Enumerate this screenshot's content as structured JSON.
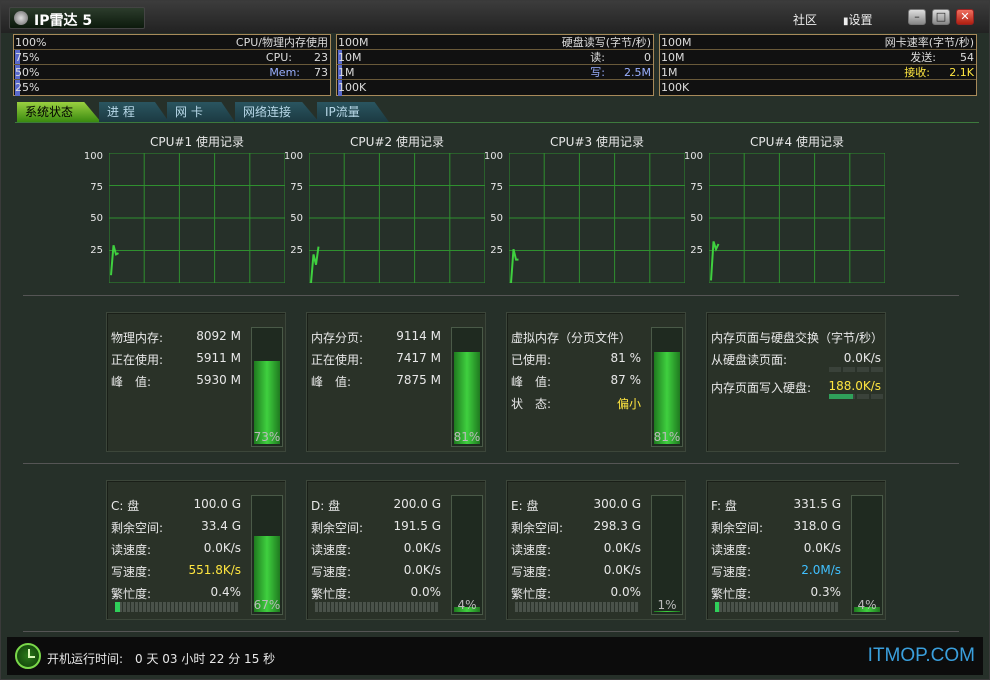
{
  "app": {
    "title": "IP雷达 5"
  },
  "titlebar": {
    "community": "社区",
    "settings": "设置",
    "minimize": "–",
    "maximize": "□",
    "close": "✕"
  },
  "meters": {
    "cpu": {
      "scale": [
        "100%",
        "75%",
        "50%",
        "25%"
      ],
      "title": "CPU/物理内存使用",
      "cpu_label": "CPU:",
      "cpu_value": "23",
      "mem_label": "Mem:",
      "mem_value": "73"
    },
    "disk": {
      "scale": [
        "100M",
        "10M",
        "1M",
        "100K"
      ],
      "title": "硬盘读写(字节/秒)",
      "read_label": "读:",
      "read_value": "0",
      "write_label": "写:",
      "write_value": "2.5M"
    },
    "net": {
      "scale": [
        "100M",
        "10M",
        "1M",
        "100K"
      ],
      "title": "网卡速率(字节/秒)",
      "send_label": "发送:",
      "send_value": "54",
      "recv_label": "接收:",
      "recv_value": "2.1K"
    }
  },
  "tabs": [
    "系统状态",
    "进 程",
    "网 卡",
    "网络连接",
    "IP流量"
  ],
  "cpu_charts": [
    {
      "title": "CPU#1 使用记录",
      "y": [
        "100",
        "75",
        "50",
        "25"
      ],
      "history": [
        6,
        29,
        22,
        23
      ]
    },
    {
      "title": "CPU#2 使用记录",
      "y": [
        "100",
        "75",
        "50",
        "25"
      ],
      "history": [
        0,
        22,
        14,
        28
      ]
    },
    {
      "title": "CPU#3 使用记录",
      "y": [
        "100",
        "75",
        "50",
        "25"
      ],
      "history": [
        0,
        26,
        18,
        18
      ]
    },
    {
      "title": "CPU#4 使用记录",
      "y": [
        "100",
        "75",
        "50",
        "25"
      ],
      "history": [
        2,
        32,
        26,
        30
      ]
    }
  ],
  "memory_panels": {
    "physical": {
      "rows": [
        {
          "label": "物理内存:",
          "value": "8092 M"
        },
        {
          "label": "正在使用:",
          "value": "5911 M"
        },
        {
          "label": "峰　值:",
          "value": "5930 M"
        }
      ],
      "percent": "73%",
      "fill": 0.73
    },
    "paging": {
      "rows": [
        {
          "label": "内存分页:",
          "value": "9114 M"
        },
        {
          "label": "正在使用:",
          "value": "7417 M"
        },
        {
          "label": "峰　值:",
          "value": "7875 M"
        }
      ],
      "percent": "81%",
      "fill": 0.81
    },
    "virtual": {
      "title": "虚拟内存（分页文件）",
      "rows": [
        {
          "label": "已使用:",
          "value": "81 %"
        },
        {
          "label": "峰　值:",
          "value": "87 %"
        },
        {
          "label": "状　态:",
          "value": "偏小"
        }
      ],
      "percent": "81%",
      "fill": 0.81
    },
    "swap": {
      "title": "内存页面与硬盘交换（字节/秒）",
      "read_label": "从硬盘读页面:",
      "read_value": "0.0K/s",
      "read_level": 0,
      "write_label": "内存页面写入硬盘:",
      "write_value": "188.0K/s",
      "write_level": 0.45
    }
  },
  "disks": [
    {
      "name": "C: 盘",
      "size": "100.0 G",
      "free_label": "剩余空间:",
      "free": "33.4 G",
      "read_label": "读速度:",
      "read": "0.0K/s",
      "write_label": "写速度:",
      "write": "551.8K/s",
      "busy_label": "繁忙度:",
      "busy": "0.4%",
      "busy_level": 0.04,
      "percent": "67%",
      "fill": 0.67,
      "write_color": "#ffe640"
    },
    {
      "name": "D: 盘",
      "size": "200.0 G",
      "free_label": "剩余空间:",
      "free": "191.5 G",
      "read_label": "读速度:",
      "read": "0.0K/s",
      "write_label": "写速度:",
      "write": "0.0K/s",
      "busy_label": "繁忙度:",
      "busy": "0.0%",
      "busy_level": 0,
      "percent": "4%",
      "fill": 0.04,
      "write_color": "#e8e8e8"
    },
    {
      "name": "E: 盘",
      "size": "300.0 G",
      "free_label": "剩余空间:",
      "free": "298.3 G",
      "read_label": "读速度:",
      "read": "0.0K/s",
      "write_label": "写速度:",
      "write": "0.0K/s",
      "busy_label": "繁忙度:",
      "busy": "0.0%",
      "busy_level": 0,
      "percent": "1%",
      "fill": 0.01,
      "write_color": "#e8e8e8"
    },
    {
      "name": "F: 盘",
      "size": "331.5 G",
      "free_label": "剩余空间:",
      "free": "318.0 G",
      "read_label": "读速度:",
      "read": "0.0K/s",
      "write_label": "写速度:",
      "write": "2.0M/s",
      "busy_label": "繁忙度:",
      "busy": "0.3%",
      "busy_level": 0.03,
      "percent": "4%",
      "fill": 0.04,
      "write_color": "#40c0ff"
    }
  ],
  "status": {
    "uptime_label": "开机运行时间:",
    "uptime": "0 天 03 小时 22 分 15 秒"
  },
  "watermark": "ITMOP.COM",
  "colors": {
    "accent_green": "#3fd03f",
    "tab_active": "#9ad040",
    "meter_border": "#a88a5a",
    "cpu_line": "#3fd03f",
    "grid": "#2f8f2f"
  }
}
